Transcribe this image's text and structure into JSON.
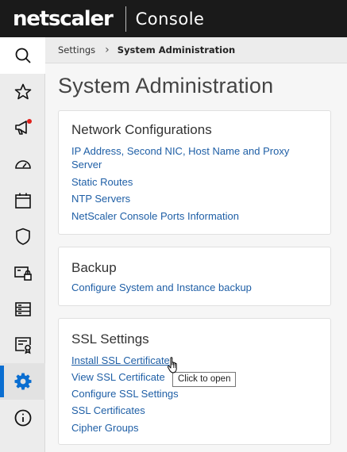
{
  "header": {
    "brand": "netscaler",
    "product": "Console"
  },
  "sidebar": {
    "items": [
      {
        "icon": "search-icon"
      },
      {
        "icon": "star-icon"
      },
      {
        "icon": "megaphone-icon",
        "notification": true
      },
      {
        "icon": "gauge-icon"
      },
      {
        "icon": "calendar-icon"
      },
      {
        "icon": "shield-icon"
      },
      {
        "icon": "secure-device-icon"
      },
      {
        "icon": "server-list-icon"
      },
      {
        "icon": "certificate-icon"
      },
      {
        "icon": "gear-icon",
        "active": true
      },
      {
        "icon": "info-icon"
      }
    ]
  },
  "breadcrumb": {
    "parent": "Settings",
    "current": "System Administration"
  },
  "page": {
    "title": "System Administration"
  },
  "cards": {
    "network": {
      "title": "Network Configurations",
      "links": {
        "ip_line1": "IP Address, Second NIC, Host Name and Proxy",
        "ip_line2": "Server",
        "static_routes": "Static Routes",
        "ntp": "NTP Servers",
        "ports": "NetScaler Console Ports Information"
      }
    },
    "backup": {
      "title": "Backup",
      "links": {
        "configure": "Configure System and Instance backup"
      }
    },
    "ssl": {
      "title": "SSL Settings",
      "links": {
        "install": "Install SSL Certificate",
        "view": "View SSL Certificate",
        "configure": "Configure SSL Settings",
        "certificates": "SSL Certificates",
        "cipher": "Cipher Groups"
      }
    }
  },
  "tooltip": {
    "text": "Click to open"
  },
  "colors": {
    "link": "#1f5fa6",
    "accent": "#0a6ed1",
    "notification": "#e0201b",
    "header_bg": "#1a1a1a"
  }
}
